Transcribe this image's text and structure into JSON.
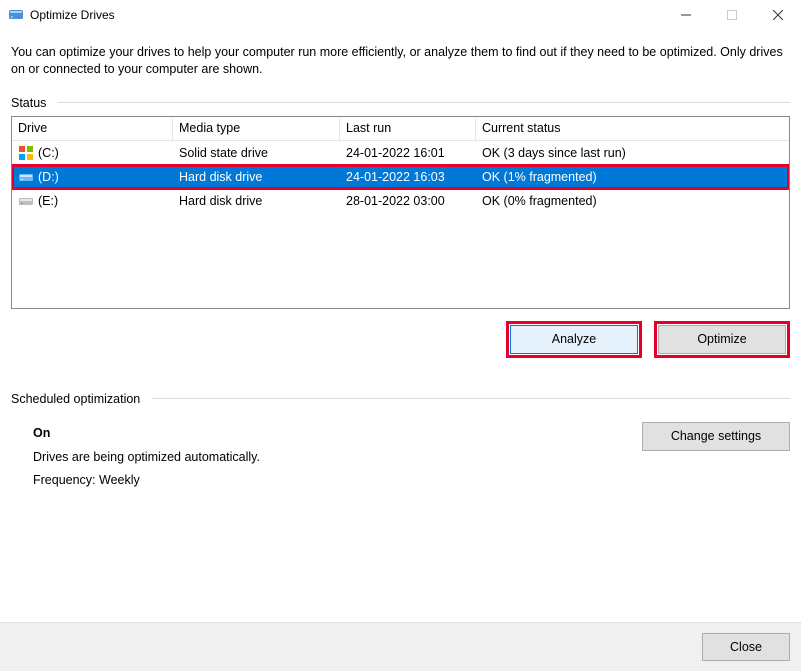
{
  "window": {
    "title": "Optimize Drives",
    "description": "You can optimize your drives to help your computer run more efficiently, or analyze them to find out if they need to be optimized. Only drives on or connected to your computer are shown."
  },
  "status_section_label": "Status",
  "columns": {
    "drive": "Drive",
    "media": "Media type",
    "lastrun": "Last run",
    "status": "Current status"
  },
  "drives": [
    {
      "name": "(C:)",
      "media": "Solid state drive",
      "lastrun": "24-01-2022 16:01",
      "status": "OK (3 days since last run)",
      "selected": false,
      "icon": "windows"
    },
    {
      "name": "(D:)",
      "media": "Hard disk drive",
      "lastrun": "24-01-2022 16:03",
      "status": "OK (1% fragmented)",
      "selected": true,
      "icon": "hdd"
    },
    {
      "name": "(E:)",
      "media": "Hard disk drive",
      "lastrun": "28-01-2022 03:00",
      "status": "OK (0% fragmented)",
      "selected": false,
      "icon": "hdd"
    }
  ],
  "buttons": {
    "analyze": "Analyze",
    "optimize": "Optimize",
    "change_settings": "Change settings",
    "close": "Close"
  },
  "scheduled": {
    "section_label": "Scheduled optimization",
    "state": "On",
    "desc": "Drives are being optimized automatically.",
    "freq": "Frequency: Weekly"
  }
}
